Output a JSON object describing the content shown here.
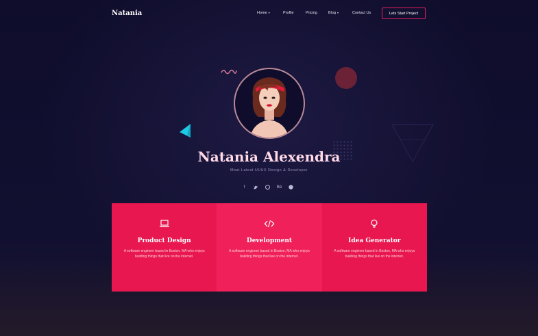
{
  "header": {
    "logo": "Natania",
    "nav": [
      {
        "label": "Home",
        "dropdown": true
      },
      {
        "label": "Profile",
        "dropdown": false
      },
      {
        "label": "Pricing",
        "dropdown": false
      },
      {
        "label": "Blog",
        "dropdown": true
      },
      {
        "label": "Contact Us",
        "dropdown": false
      }
    ],
    "cta_label": "Lets Start Project"
  },
  "hero": {
    "name": "Natania Alexendra",
    "tagline": "Most Latest UI/UX Design & Developer",
    "socials": [
      "facebook-icon",
      "twitter-icon",
      "dribbble-icon",
      "behance-icon",
      "pinterest-icon"
    ]
  },
  "services": [
    {
      "icon": "laptop-icon",
      "title": "Product Design",
      "description": "A software engineer based in Boston, MA who enjoys building things that live on the internet.",
      "color": "#e8174f"
    },
    {
      "icon": "code-icon",
      "title": "Development",
      "description": "A software engineer based in Boston, MA who enjoys building things that live on the internet.",
      "color": "#f0205a"
    },
    {
      "icon": "bulb-icon",
      "title": "Idea Generator",
      "description": "A software engineer based in Boston, MA who enjoys building things that live on the internet.",
      "color": "#e8174f"
    }
  ],
  "colors": {
    "background": "#0f0d2b",
    "accent": "#e91e63",
    "card": "#e8174f"
  }
}
